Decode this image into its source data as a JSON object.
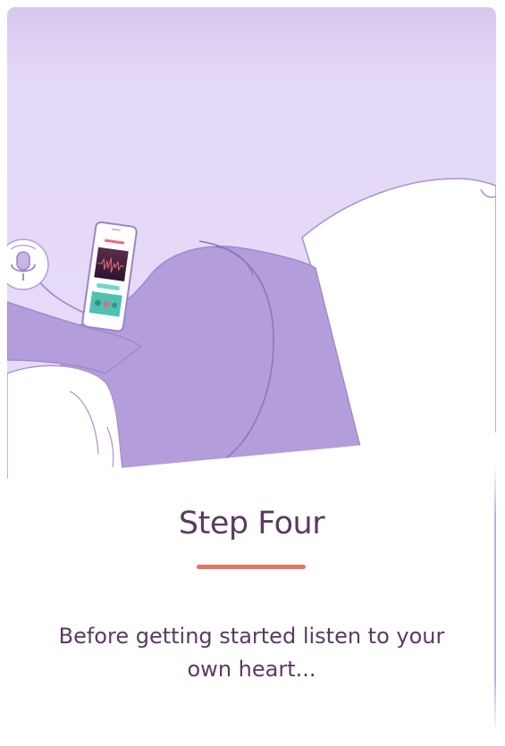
{
  "step": {
    "title": "Step Four",
    "description": "Before getting started listen to your own heart..."
  },
  "colors": {
    "background_lavender": "#e5d9f7",
    "accent_purple": "#b39ddb",
    "divider": "#e07468",
    "text": "#5b3a62"
  },
  "icons": {
    "microphone": "microphone-icon",
    "phone": "smartphone-app-illustration"
  }
}
